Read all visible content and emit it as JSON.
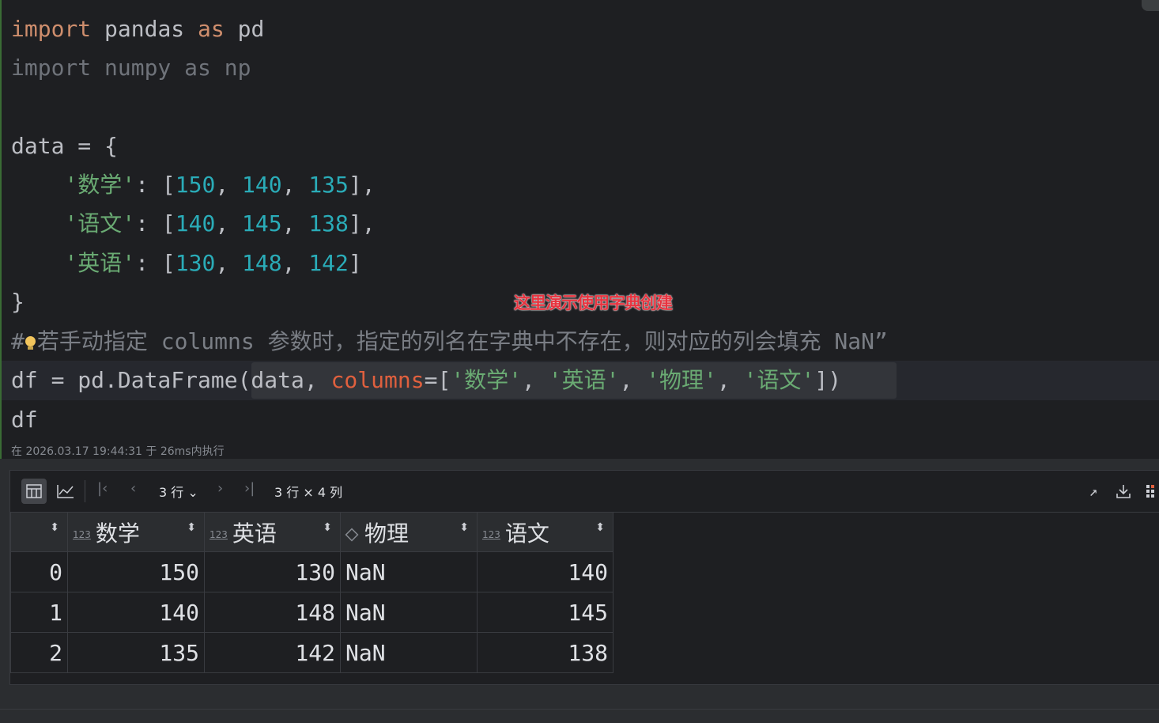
{
  "code": {
    "line1": {
      "kw1": "import",
      "mod": " pandas ",
      "kw2": "as",
      "alias": " pd"
    },
    "line2": "import numpy as np",
    "line4": "data = {",
    "rows": [
      {
        "key": "'数学'",
        "v1": "150",
        "v2": "140",
        "v3": "135",
        "end": "],"
      },
      {
        "key": "'语文'",
        "v1": "140",
        "v2": "145",
        "v3": "138",
        "end": "],"
      },
      {
        "key": "'英语'",
        "v1": "130",
        "v2": "148",
        "v3": "142",
        "end": "]"
      }
    ],
    "close": "}",
    "comment_hash": "#",
    "comment": "若手动指定 columns 参数时，指定的列名在字典中不存在，则对应的列会填充 NaN”",
    "df_line": {
      "pre": "df = pd.DataFrame(data, ",
      "param": "columns",
      "eq": "=[",
      "c1": "'数学'",
      "c2": "'英语'",
      "c3": "'物理'",
      "c4": "'语文'",
      "post": "])"
    },
    "last": "df"
  },
  "annotation": "这里演示使用字典创建",
  "exec_info": "在 2026.03.17 19:44:31 于 26ms内执行",
  "toolbar": {
    "rows_select": "3 行",
    "shape": "3 行 × 4 列"
  },
  "table": {
    "columns": [
      {
        "name": "数学",
        "type": "123"
      },
      {
        "name": "英语",
        "type": "123"
      },
      {
        "name": "物理",
        "type": "obj"
      },
      {
        "name": "语文",
        "type": "123"
      }
    ],
    "rows": [
      {
        "idx": "0",
        "c": [
          "150",
          "130",
          "NaN",
          "140"
        ]
      },
      {
        "idx": "1",
        "c": [
          "140",
          "148",
          "NaN",
          "145"
        ]
      },
      {
        "idx": "2",
        "c": [
          "135",
          "142",
          "NaN",
          "138"
        ]
      }
    ]
  },
  "colors": {
    "keyword": "#cf8e6d",
    "string": "#6aab73",
    "number": "#2aacb8",
    "param": "#e0603e",
    "annotation": "#e8333f"
  }
}
